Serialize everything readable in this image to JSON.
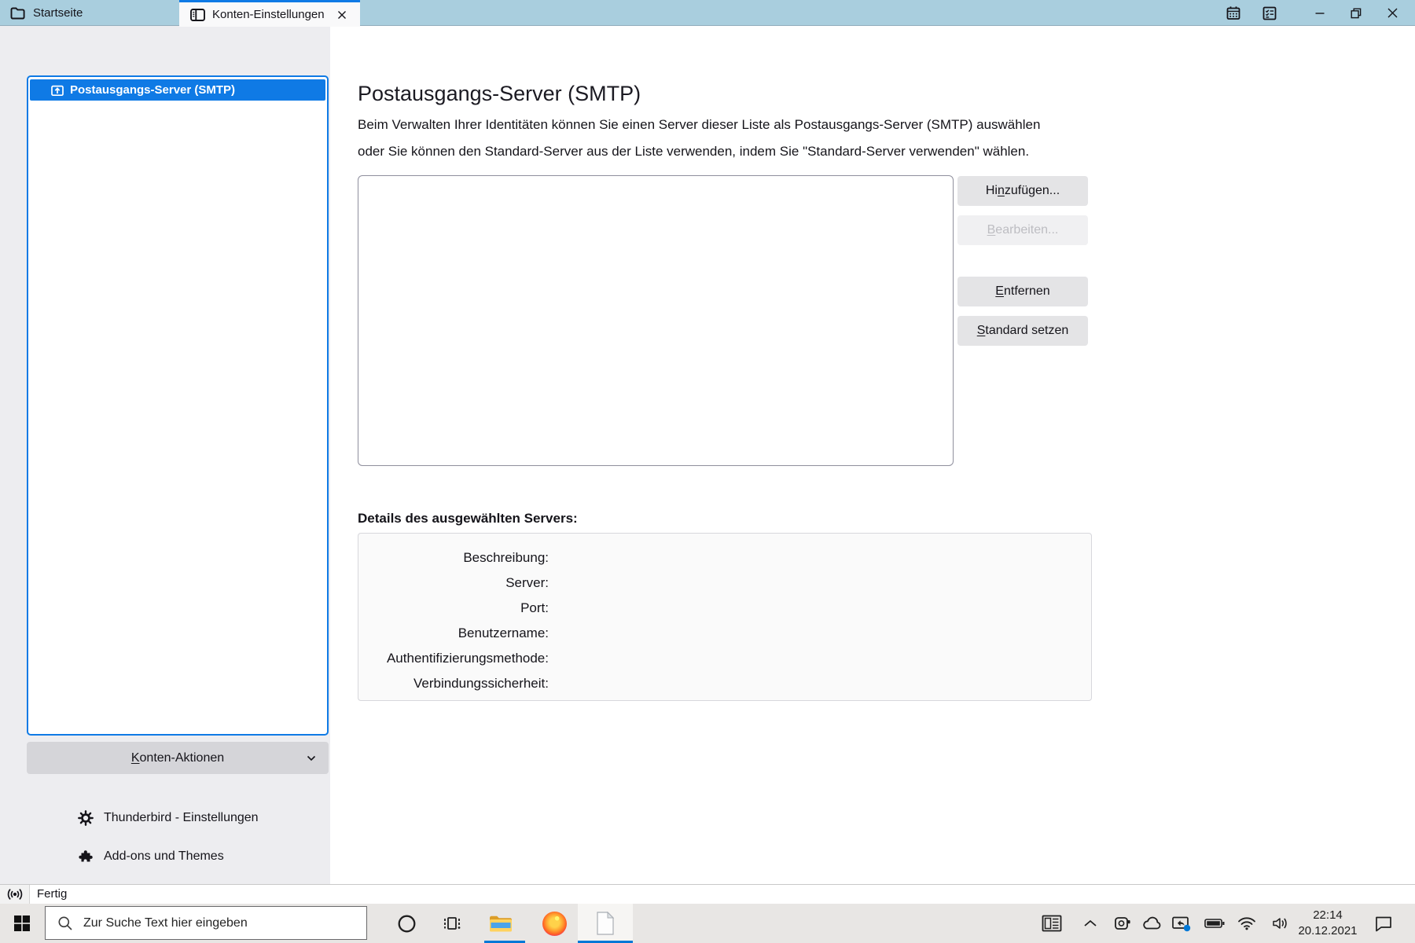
{
  "titlebar": {
    "tabs": [
      {
        "label": "Startseite"
      },
      {
        "label": "Konten-Einstellungen"
      }
    ]
  },
  "sidebar": {
    "selected_item": {
      "label": "Postausgangs-Server (SMTP)"
    },
    "actions_button": {
      "pre": "",
      "key": "K",
      "post": "onten-Aktionen"
    },
    "footer": [
      {
        "label": "Thunderbird - Einstellungen"
      },
      {
        "label": "Add-ons und Themes"
      }
    ]
  },
  "main": {
    "title": "Postausgangs-Server (SMTP)",
    "description_line1": "Beim Verwalten Ihrer Identitäten können Sie einen Server dieser Liste als Postausgangs-Server (SMTP) auswählen",
    "description_line2": "oder Sie können den Standard-Server aus der Liste verwenden, indem Sie \"Standard-Server verwenden\" wählen.",
    "buttons": {
      "add": {
        "pre": "Hi",
        "key": "n",
        "post": "zufügen..."
      },
      "edit": {
        "pre": "",
        "key": "B",
        "post": "earbeiten..."
      },
      "remove": {
        "pre": "",
        "key": "E",
        "post": "ntfernen"
      },
      "set_default": {
        "pre": "",
        "key": "S",
        "post": "tandard setzen"
      }
    },
    "details_heading": "Details des ausgewählten Servers:",
    "details_labels": [
      "Beschreibung:",
      "Server:",
      "Port:",
      "Benutzername:",
      "Authentifizierungsmethode:",
      "Verbindungssicherheit:"
    ]
  },
  "statusbar": {
    "text": "Fertig"
  },
  "taskbar": {
    "search_placeholder": "Zur Suche Text hier eingeben",
    "clock": {
      "time": "22:14",
      "date": "20.12.2021"
    }
  },
  "colors": {
    "accent": "#0f7ae5",
    "taskbar_accent": "#0078d7",
    "titlebar_bg": "#a9cede"
  },
  "icons": [
    "folder-icon",
    "account-settings-icon",
    "tab-close-icon",
    "calendar-icon",
    "tasks-icon",
    "minimize-icon",
    "restore-icon",
    "close-icon",
    "smtp-outbox-icon",
    "chevron-down-icon",
    "gear-icon",
    "puzzle-icon",
    "broadcast-icon",
    "windows-logo-icon",
    "search-icon",
    "cortana-icon",
    "task-view-icon",
    "file-explorer-icon",
    "firefox-icon",
    "document-icon",
    "news-icon",
    "chevron-up-icon",
    "device-icon",
    "cloud-icon",
    "cast-icon",
    "battery-icon",
    "wifi-icon",
    "volume-icon",
    "action-center-icon"
  ]
}
